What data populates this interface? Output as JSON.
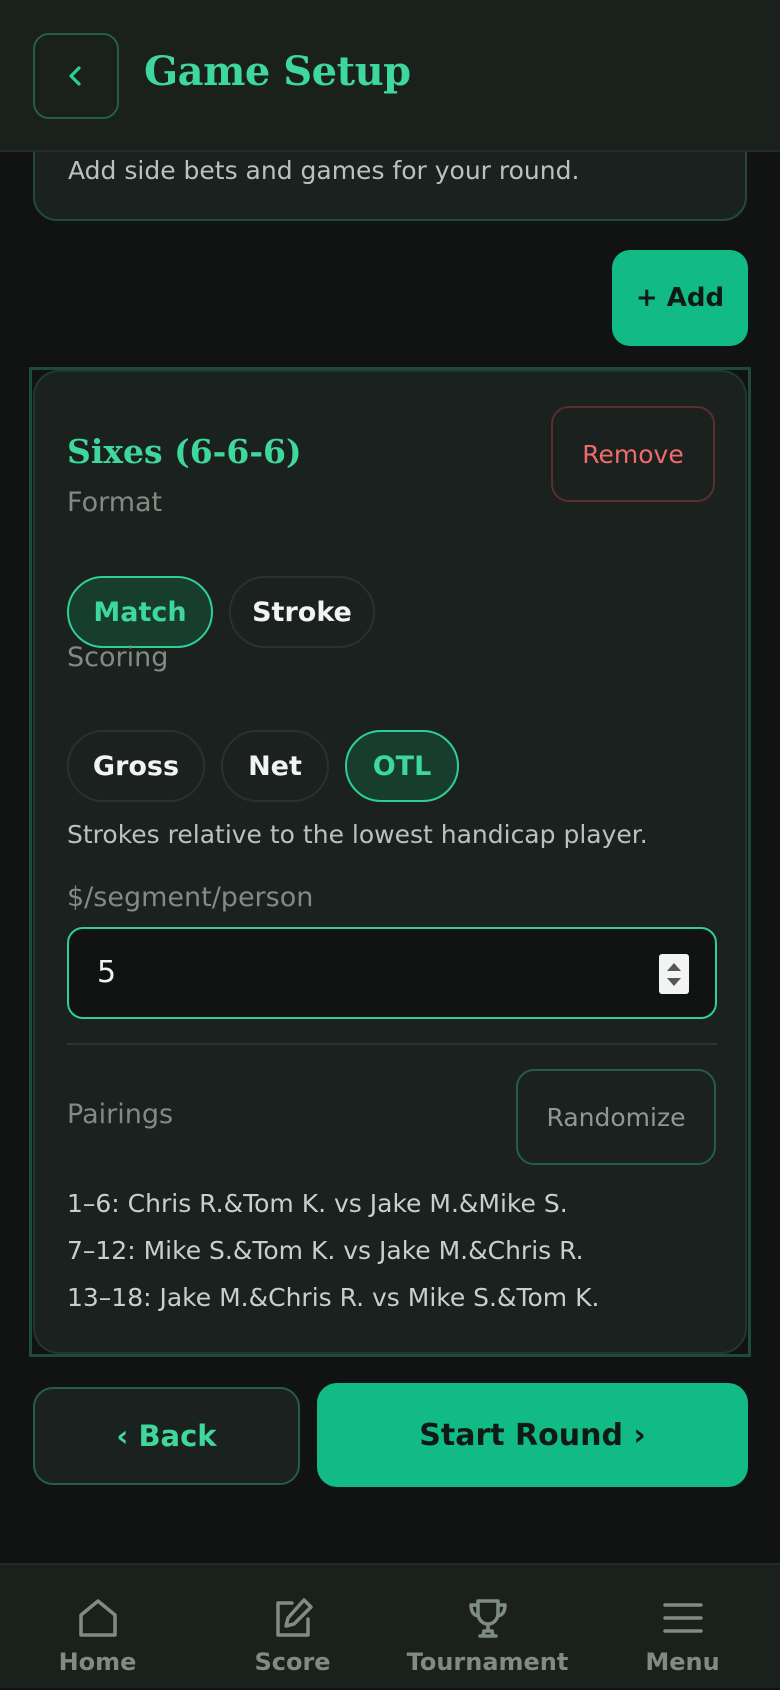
{
  "header": {
    "title": "Game Setup",
    "back_icon": "chevron-left-icon"
  },
  "intro": {
    "text": "Add side bets and games for your round."
  },
  "add_button": "+ Add",
  "game": {
    "title": "Sixes (6-6-6)",
    "remove_label": "Remove",
    "format_label": "Format",
    "format_options": [
      "Match",
      "Stroke"
    ],
    "format_selected": "Match",
    "scoring_label": "Scoring",
    "scoring_options": [
      "Gross",
      "Net",
      "OTL"
    ],
    "scoring_selected": "OTL",
    "scoring_help": "Strokes relative to the lowest handicap player.",
    "amount_label": "$/segment/person",
    "amount_value": "5",
    "pairings_label": "Pairings",
    "randomize_label": "Randomize",
    "pairings": [
      "1–6: Chris R.&Tom K. vs Jake M.&Mike S.",
      "7–12: Mike S.&Tom K. vs Jake M.&Chris R.",
      "13–18: Jake M.&Chris R. vs Mike S.&Tom K."
    ]
  },
  "footer_actions": {
    "back_label": "‹ Back",
    "start_label": "Start Round ›"
  },
  "nav": {
    "items": [
      {
        "label": "Home",
        "icon": "home-icon"
      },
      {
        "label": "Score",
        "icon": "edit-icon"
      },
      {
        "label": "Tournament",
        "icon": "trophy-icon"
      },
      {
        "label": "Menu",
        "icon": "menu-icon"
      }
    ]
  },
  "colors": {
    "accent": "#12bb86",
    "accent_text": "#3ed79c",
    "background": "#101311",
    "card": "#1b211e",
    "danger": "#ef6b6b"
  }
}
